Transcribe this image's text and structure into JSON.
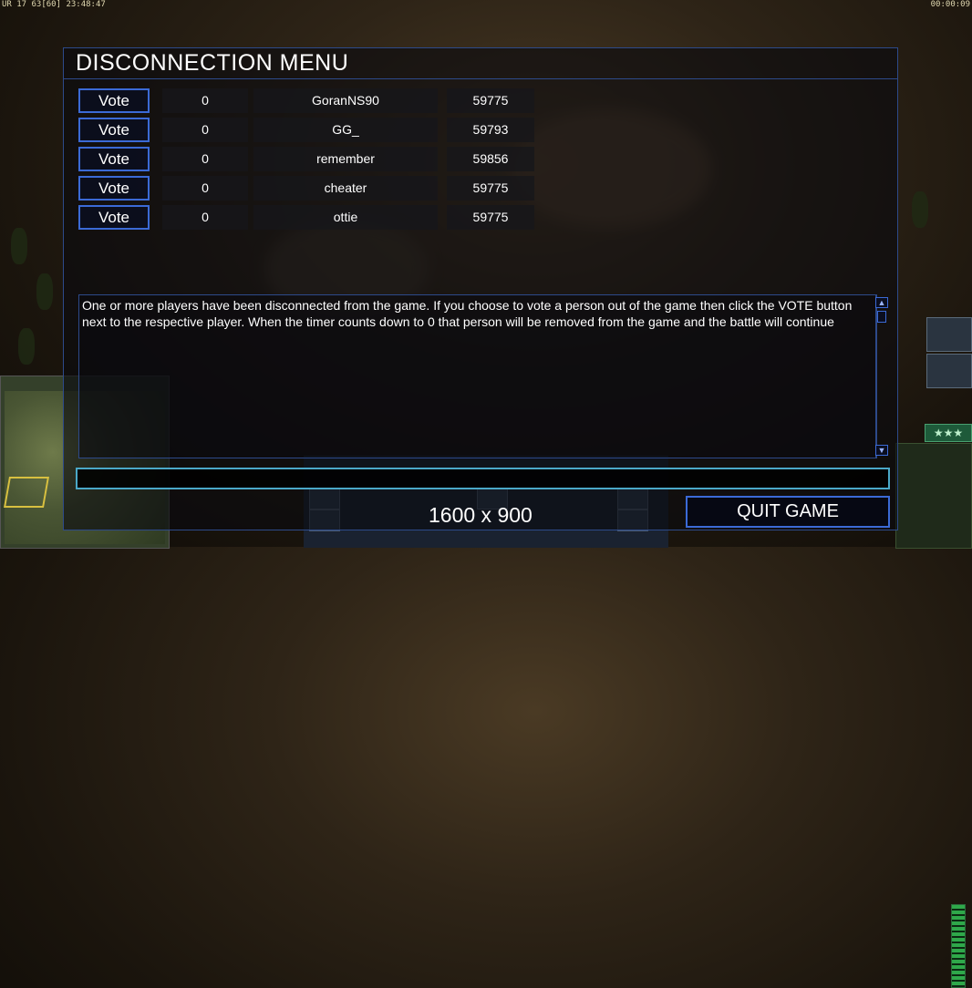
{
  "hud": {
    "top_left": "UR 17 63[60] 23:48:47",
    "top_right": "00:00:09"
  },
  "dialog": {
    "title": "DISCONNECTION MENU",
    "players": [
      {
        "vote_label": "Vote",
        "count": "0",
        "name": "GoranNS90",
        "ping": "59775"
      },
      {
        "vote_label": "Vote",
        "count": "0",
        "name": "GG_",
        "ping": "59793"
      },
      {
        "vote_label": "Vote",
        "count": "0",
        "name": "remember",
        "ping": "59856"
      },
      {
        "vote_label": "Vote",
        "count": "0",
        "name": "cheater",
        "ping": "59775"
      },
      {
        "vote_label": "Vote",
        "count": "0",
        "name": "ottie",
        "ping": "59775"
      }
    ],
    "message": "One or more players have been disconnected from the game. If you choose to vote a person out of the game then click the VOTE button next to the respective player. When the timer counts down to 0 that person will be removed from the game and the battle will continue",
    "chat_value": "",
    "quit_label": "QUIT GAME"
  },
  "overlay": {
    "resolution": "1600 x 900"
  },
  "rank": {
    "stars": "★★★"
  },
  "colors": {
    "border": "#2d4a8a",
    "button_border": "#3b6ad6",
    "chat_border": "#4aa8c8"
  },
  "icons": [
    "arrow-up-icon",
    "arrow-down-icon",
    "star-icon"
  ]
}
